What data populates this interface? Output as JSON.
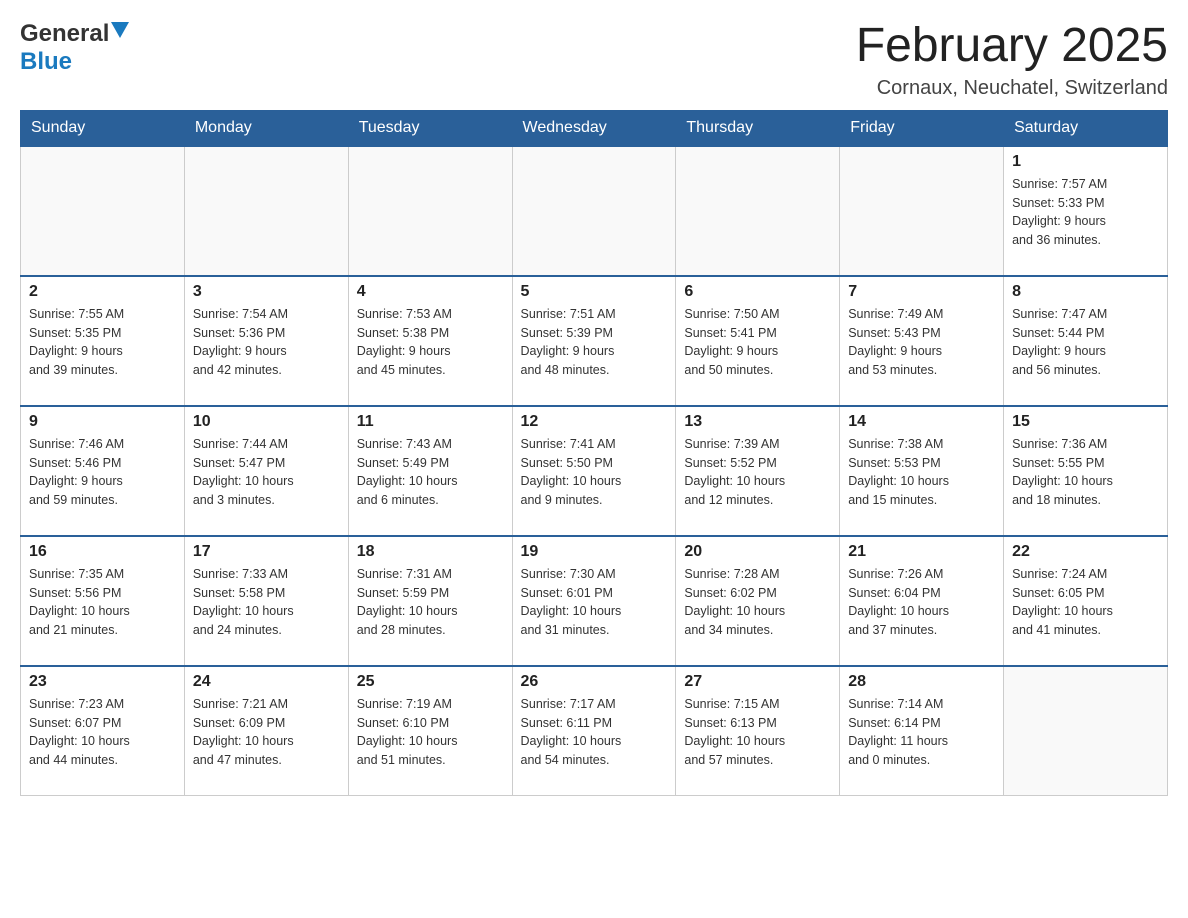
{
  "header": {
    "logo_general": "General",
    "logo_blue": "Blue",
    "month_title": "February 2025",
    "location": "Cornaux, Neuchatel, Switzerland"
  },
  "days_of_week": [
    "Sunday",
    "Monday",
    "Tuesday",
    "Wednesday",
    "Thursday",
    "Friday",
    "Saturday"
  ],
  "weeks": [
    [
      {
        "day": "",
        "info": ""
      },
      {
        "day": "",
        "info": ""
      },
      {
        "day": "",
        "info": ""
      },
      {
        "day": "",
        "info": ""
      },
      {
        "day": "",
        "info": ""
      },
      {
        "day": "",
        "info": ""
      },
      {
        "day": "1",
        "info": "Sunrise: 7:57 AM\nSunset: 5:33 PM\nDaylight: 9 hours\nand 36 minutes."
      }
    ],
    [
      {
        "day": "2",
        "info": "Sunrise: 7:55 AM\nSunset: 5:35 PM\nDaylight: 9 hours\nand 39 minutes."
      },
      {
        "day": "3",
        "info": "Sunrise: 7:54 AM\nSunset: 5:36 PM\nDaylight: 9 hours\nand 42 minutes."
      },
      {
        "day": "4",
        "info": "Sunrise: 7:53 AM\nSunset: 5:38 PM\nDaylight: 9 hours\nand 45 minutes."
      },
      {
        "day": "5",
        "info": "Sunrise: 7:51 AM\nSunset: 5:39 PM\nDaylight: 9 hours\nand 48 minutes."
      },
      {
        "day": "6",
        "info": "Sunrise: 7:50 AM\nSunset: 5:41 PM\nDaylight: 9 hours\nand 50 minutes."
      },
      {
        "day": "7",
        "info": "Sunrise: 7:49 AM\nSunset: 5:43 PM\nDaylight: 9 hours\nand 53 minutes."
      },
      {
        "day": "8",
        "info": "Sunrise: 7:47 AM\nSunset: 5:44 PM\nDaylight: 9 hours\nand 56 minutes."
      }
    ],
    [
      {
        "day": "9",
        "info": "Sunrise: 7:46 AM\nSunset: 5:46 PM\nDaylight: 9 hours\nand 59 minutes."
      },
      {
        "day": "10",
        "info": "Sunrise: 7:44 AM\nSunset: 5:47 PM\nDaylight: 10 hours\nand 3 minutes."
      },
      {
        "day": "11",
        "info": "Sunrise: 7:43 AM\nSunset: 5:49 PM\nDaylight: 10 hours\nand 6 minutes."
      },
      {
        "day": "12",
        "info": "Sunrise: 7:41 AM\nSunset: 5:50 PM\nDaylight: 10 hours\nand 9 minutes."
      },
      {
        "day": "13",
        "info": "Sunrise: 7:39 AM\nSunset: 5:52 PM\nDaylight: 10 hours\nand 12 minutes."
      },
      {
        "day": "14",
        "info": "Sunrise: 7:38 AM\nSunset: 5:53 PM\nDaylight: 10 hours\nand 15 minutes."
      },
      {
        "day": "15",
        "info": "Sunrise: 7:36 AM\nSunset: 5:55 PM\nDaylight: 10 hours\nand 18 minutes."
      }
    ],
    [
      {
        "day": "16",
        "info": "Sunrise: 7:35 AM\nSunset: 5:56 PM\nDaylight: 10 hours\nand 21 minutes."
      },
      {
        "day": "17",
        "info": "Sunrise: 7:33 AM\nSunset: 5:58 PM\nDaylight: 10 hours\nand 24 minutes."
      },
      {
        "day": "18",
        "info": "Sunrise: 7:31 AM\nSunset: 5:59 PM\nDaylight: 10 hours\nand 28 minutes."
      },
      {
        "day": "19",
        "info": "Sunrise: 7:30 AM\nSunset: 6:01 PM\nDaylight: 10 hours\nand 31 minutes."
      },
      {
        "day": "20",
        "info": "Sunrise: 7:28 AM\nSunset: 6:02 PM\nDaylight: 10 hours\nand 34 minutes."
      },
      {
        "day": "21",
        "info": "Sunrise: 7:26 AM\nSunset: 6:04 PM\nDaylight: 10 hours\nand 37 minutes."
      },
      {
        "day": "22",
        "info": "Sunrise: 7:24 AM\nSunset: 6:05 PM\nDaylight: 10 hours\nand 41 minutes."
      }
    ],
    [
      {
        "day": "23",
        "info": "Sunrise: 7:23 AM\nSunset: 6:07 PM\nDaylight: 10 hours\nand 44 minutes."
      },
      {
        "day": "24",
        "info": "Sunrise: 7:21 AM\nSunset: 6:09 PM\nDaylight: 10 hours\nand 47 minutes."
      },
      {
        "day": "25",
        "info": "Sunrise: 7:19 AM\nSunset: 6:10 PM\nDaylight: 10 hours\nand 51 minutes."
      },
      {
        "day": "26",
        "info": "Sunrise: 7:17 AM\nSunset: 6:11 PM\nDaylight: 10 hours\nand 54 minutes."
      },
      {
        "day": "27",
        "info": "Sunrise: 7:15 AM\nSunset: 6:13 PM\nDaylight: 10 hours\nand 57 minutes."
      },
      {
        "day": "28",
        "info": "Sunrise: 7:14 AM\nSunset: 6:14 PM\nDaylight: 11 hours\nand 0 minutes."
      },
      {
        "day": "",
        "info": ""
      }
    ]
  ]
}
